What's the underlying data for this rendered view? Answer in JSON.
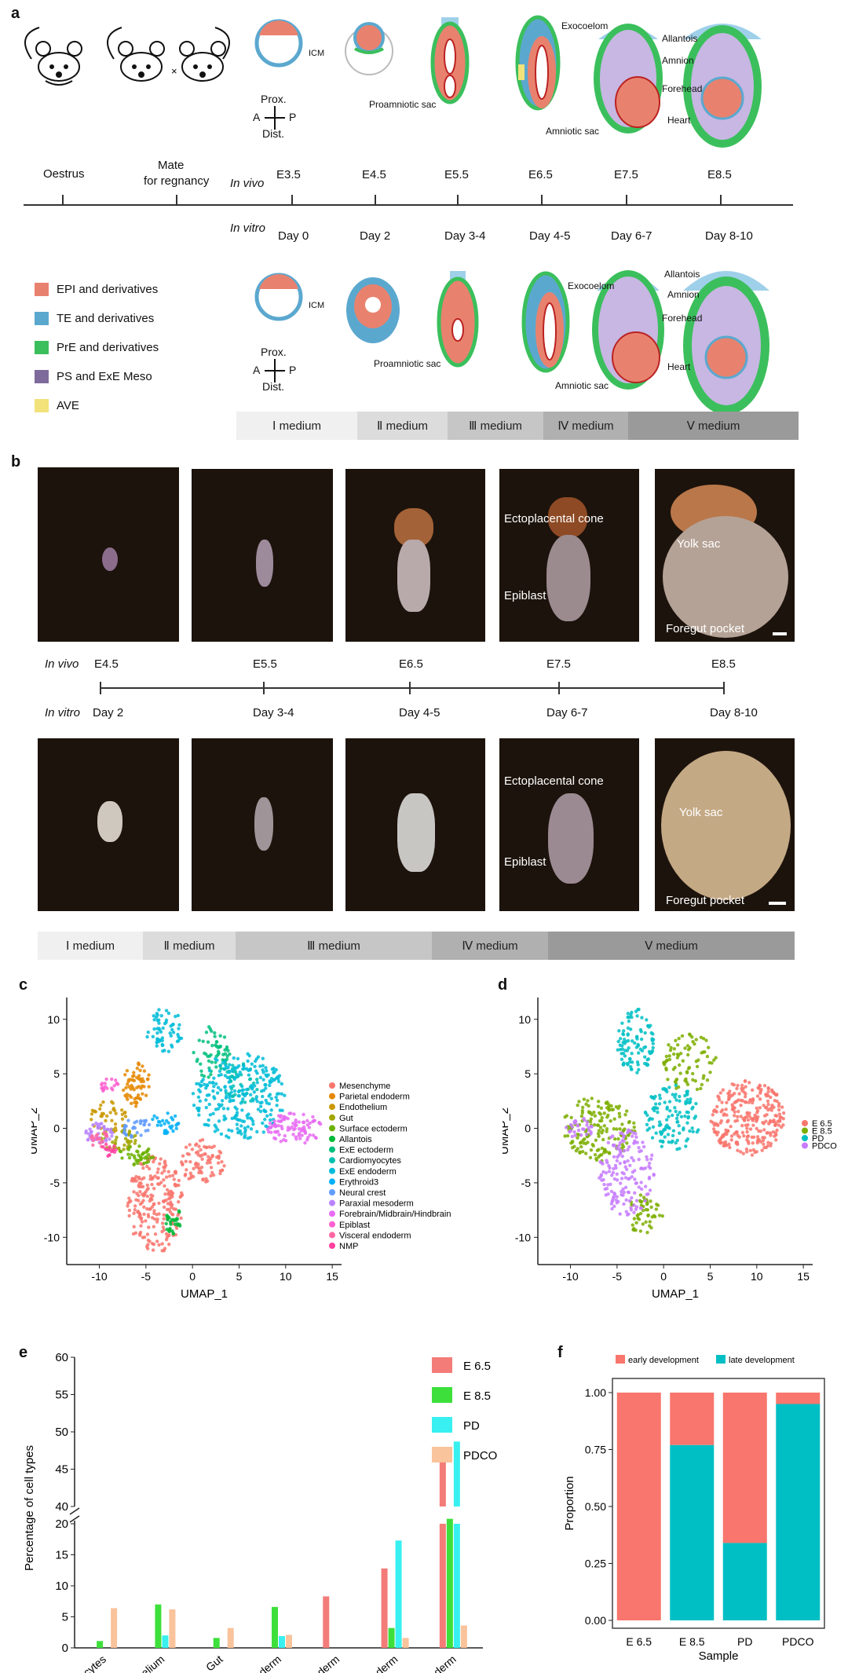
{
  "panels": {
    "a": "a",
    "b": "b",
    "c": "c",
    "d": "d",
    "e": "e",
    "f": "f"
  },
  "panel_a": {
    "timeline_top": [
      "Oestrus",
      "Mate",
      "for regnancy"
    ],
    "in_vivo_label": "In vivo",
    "in_vitro_label": "In vitro",
    "in_vivo_stages": [
      "E3.5",
      "E4.5",
      "E5.5",
      "E6.5",
      "E7.5",
      "E8.5"
    ],
    "in_vitro_stages": [
      "Day 0",
      "Day 2",
      "Day 3-4",
      "Day 4-5",
      "Day 6-7",
      "Day 8-10"
    ],
    "axis": {
      "prox": "Prox.",
      "dist": "Dist.",
      "a": "A",
      "p": "P"
    },
    "annotations": {
      "icm": "ICM",
      "proamniotic": "Proamniotic sac",
      "amniotic": "Amniotic  sac",
      "exocoelom": "Exocoelom",
      "allantois": "Allantois",
      "amnion": "Amnion",
      "forehead": "Forehead",
      "heart": "Heart"
    },
    "legend": [
      {
        "label": "EPI and derivatives",
        "color": "#e8826e"
      },
      {
        "label": "TE and derivatives",
        "color": "#5ba8cf"
      },
      {
        "label": "PrE and derivatives",
        "color": "#3bbf5c"
      },
      {
        "label": "PS and ExE Meso",
        "color": "#7e6b9c"
      },
      {
        "label": "AVE",
        "color": "#f2e27a"
      }
    ],
    "medium_bar": [
      {
        "label": "Ⅰ medium",
        "color": "#f0f0f0"
      },
      {
        "label": "Ⅱ medium",
        "color": "#dcdcdc"
      },
      {
        "label": "Ⅲ medium",
        "color": "#c6c6c6"
      },
      {
        "label": "Ⅳ medium",
        "color": "#b0b0b0"
      },
      {
        "label": "Ⅴ medium",
        "color": "#9a9a9a"
      }
    ]
  },
  "panel_b": {
    "in_vivo_label": "In vivo",
    "in_vitro_label": "In vitro",
    "in_vivo_stages": [
      "E4.5",
      "E5.5",
      "E6.5",
      "E7.5",
      "E8.5"
    ],
    "in_vitro_stages": [
      "Day 2",
      "Day 3-4",
      "Day 4-5",
      "Day 6-7",
      "Day 8-10"
    ],
    "labels": {
      "ectoplacental": "Ectoplacental cone",
      "epiblast": "Epiblast",
      "yolk": "Yolk sac",
      "foregut": "Foregut pocket"
    },
    "medium_bar": [
      {
        "label": "Ⅰ medium",
        "color": "#f0f0f0"
      },
      {
        "label": "Ⅱ medium",
        "color": "#dcdcdc"
      },
      {
        "label": "Ⅲ medium",
        "color": "#c6c6c6"
      },
      {
        "label": "Ⅳ medium",
        "color": "#b0b0b0"
      },
      {
        "label": "Ⅴ medium",
        "color": "#9a9a9a"
      }
    ]
  },
  "panel_c": {
    "xlabel": "UMAP_1",
    "ylabel": "UMAP_2",
    "xticks": [
      "-10",
      "-5",
      "0",
      "5",
      "10",
      "15"
    ],
    "yticks": [
      "10",
      "5",
      "0",
      "-5",
      "-10"
    ],
    "legend": [
      {
        "label": "Mesenchyme",
        "color": "#f8766d"
      },
      {
        "label": "Parietal endoderm",
        "color": "#e58700"
      },
      {
        "label": "Endothelium",
        "color": "#c99800"
      },
      {
        "label": "Gut",
        "color": "#a3a500"
      },
      {
        "label": "Surface ectoderm",
        "color": "#6bb100"
      },
      {
        "label": "Allantois",
        "color": "#00ba38"
      },
      {
        "label": "ExE ectoderm",
        "color": "#00bf7d"
      },
      {
        "label": "Cardiomyocytes",
        "color": "#00c0af"
      },
      {
        "label": "ExE endoderm",
        "color": "#00bcd8"
      },
      {
        "label": "Erythroid3",
        "color": "#00b0f6"
      },
      {
        "label": "Neural crest",
        "color": "#619cff"
      },
      {
        "label": "Paraxial mesoderm",
        "color": "#b983ff"
      },
      {
        "label": "Forebrain/Midbrain/Hindbrain",
        "color": "#e76bf3"
      },
      {
        "label": "Epiblast",
        "color": "#fd61d1"
      },
      {
        "label": "Visceral endoderm",
        "color": "#ff67a4"
      },
      {
        "label": "NMP",
        "color": "#ff3fa0"
      }
    ]
  },
  "panel_d": {
    "xlabel": "UMAP_1",
    "ylabel": "UMAP_2",
    "xticks": [
      "-10",
      "-5",
      "0",
      "5",
      "10",
      "15"
    ],
    "yticks": [
      "10",
      "5",
      "0",
      "-5",
      "-10"
    ],
    "legend": [
      {
        "label": "E 6.5",
        "color": "#f8766d"
      },
      {
        "label": "E 8.5",
        "color": "#7cae00"
      },
      {
        "label": "PD",
        "color": "#00bfc4"
      },
      {
        "label": "PDCO",
        "color": "#c77cff"
      }
    ]
  },
  "chart_data": [
    {
      "type": "bar",
      "panel": "e",
      "ylabel": "Percentage of cell types",
      "categories": [
        "Cardiomyocytes",
        "Endothelium",
        "Gut",
        "Surface ectoderm",
        "Visceral endoderm",
        "EXE ectoderm",
        "EXE endoderm"
      ],
      "series": [
        {
          "name": "E 6.5",
          "color": "#f37c78",
          "values": [
            0,
            0,
            0,
            0,
            8.3,
            12.8,
            47.5
          ]
        },
        {
          "name": "E 8.5",
          "color": "#3de03a",
          "values": [
            1.1,
            7.0,
            1.6,
            6.6,
            0,
            3.2,
            20.8
          ]
        },
        {
          "name": "PD",
          "color": "#38f0f0",
          "values": [
            0,
            2.0,
            0,
            1.9,
            0,
            17.3,
            48.7
          ]
        },
        {
          "name": "PDCO",
          "color": "#f9c39c",
          "values": [
            6.4,
            6.2,
            3.2,
            2.1,
            0,
            1.6,
            3.6
          ]
        }
      ],
      "yticks_lower": [
        "0",
        "5",
        "10",
        "15",
        "20"
      ],
      "yticks_upper": [
        "40",
        "45",
        "50",
        "55",
        "60"
      ],
      "axis_break": [
        22,
        38
      ],
      "ylim": [
        0,
        60
      ]
    },
    {
      "type": "bar",
      "panel": "f",
      "stacked": true,
      "xlabel": "Sample",
      "ylabel": "Proportion",
      "categories": [
        "E 6.5",
        "E 8.5",
        "PD",
        "PDCO"
      ],
      "series": [
        {
          "name": "early development",
          "color": "#f8766d",
          "values": [
            1.0,
            0.23,
            0.66,
            0.05
          ]
        },
        {
          "name": "late development",
          "color": "#00bfc4",
          "values": [
            0.0,
            0.77,
            0.34,
            0.95
          ]
        }
      ],
      "yticks": [
        "0.00",
        "0.25",
        "0.50",
        "0.75",
        "1.00"
      ],
      "ylim": [
        0,
        1
      ]
    }
  ]
}
